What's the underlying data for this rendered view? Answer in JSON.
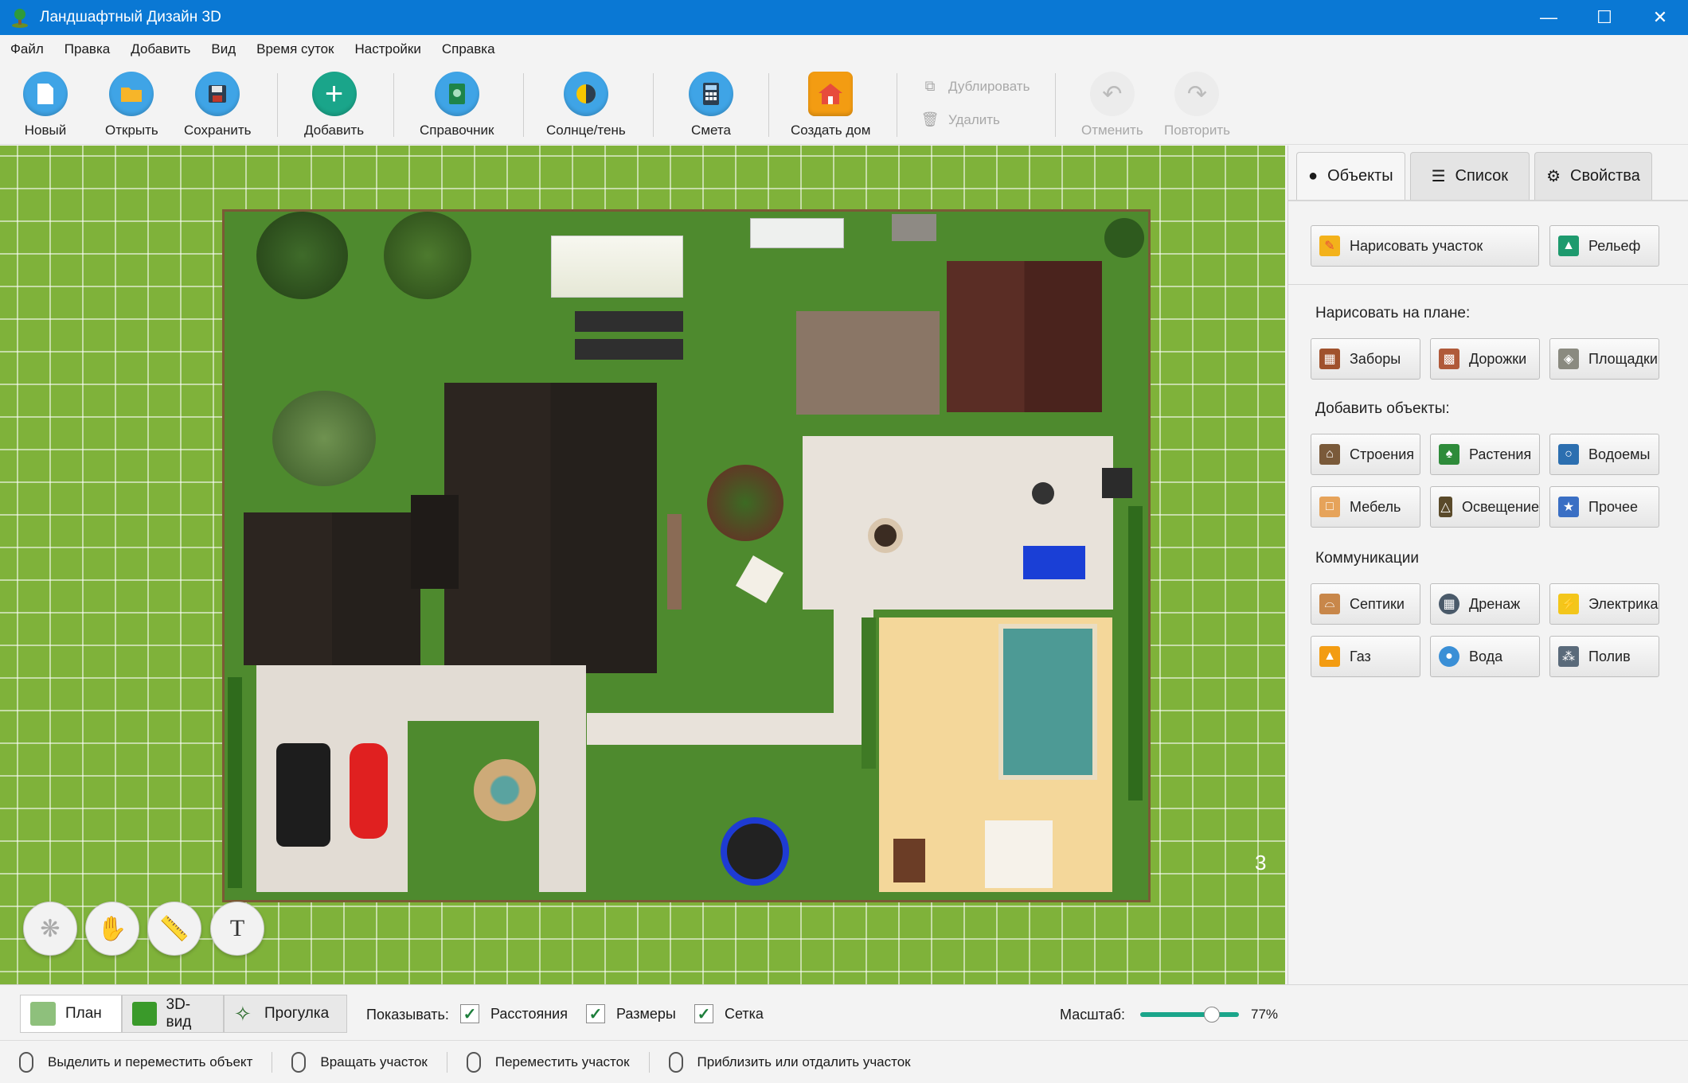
{
  "window": {
    "title": "Ландшафтный Дизайн 3D"
  },
  "menu": [
    "Файл",
    "Правка",
    "Добавить",
    "Вид",
    "Время суток",
    "Настройки",
    "Справка"
  ],
  "toolbar": {
    "new": "Новый",
    "open": "Открыть",
    "save": "Сохранить",
    "add": "Добавить",
    "reference": "Справочник",
    "sun_shade": "Солнце/тень",
    "estimate": "Смета",
    "create_house": "Создать дом",
    "duplicate": "Дублировать",
    "delete": "Удалить",
    "undo": "Отменить",
    "redo": "Повторить"
  },
  "panel": {
    "tabs": [
      "Объекты",
      "Список",
      "Свойства"
    ],
    "draw_plot": "Нарисовать участок",
    "relief": "Рельеф",
    "section_draw": "Нарисовать на плане:",
    "draw_items": [
      "Заборы",
      "Дорожки",
      "Площадки"
    ],
    "section_add": "Добавить объекты:",
    "add_items": [
      "Строения",
      "Растения",
      "Водоемы",
      "Мебель",
      "Освещение",
      "Прочее"
    ],
    "section_comm": "Коммуникации",
    "comm_items": [
      "Септики",
      "Дренаж",
      "Электрика",
      "Газ",
      "Вода",
      "Полив"
    ]
  },
  "canvas": {
    "edge_label": "3"
  },
  "bottom": {
    "views": [
      "План",
      "3D-вид",
      "Прогулка"
    ],
    "show_label": "Показывать:",
    "checks": [
      "Расстояния",
      "Размеры",
      "Сетка"
    ],
    "scale_label": "Масштаб:",
    "scale_value": "77%",
    "scale_level": 0.77
  },
  "status": [
    "Выделить и переместить объект",
    "Вращать участок",
    "Переместить участок",
    "Приблизить или отдалить участок"
  ],
  "colors": {
    "titlebar": "#0a78d4",
    "grass": "#4e8a2e",
    "accent_teal": "#1aa58a"
  }
}
